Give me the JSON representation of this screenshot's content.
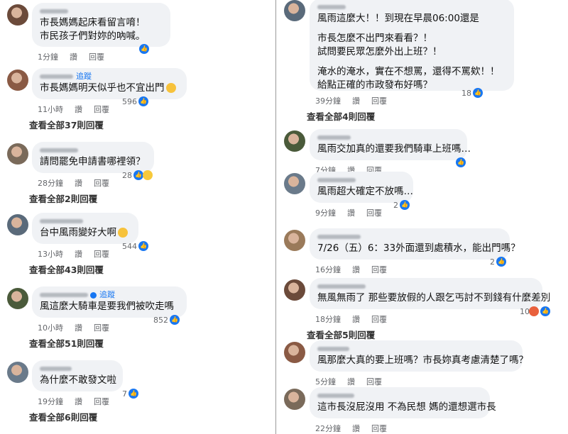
{
  "labels": {
    "like": "讚",
    "reply": "回覆",
    "follow": "追蹤"
  },
  "left": [
    {
      "lines": [
        "市長媽媽起床看留言唷！",
        "市民孩子們對妳的吶喊。"
      ],
      "time": "1分鐘",
      "count": "",
      "view_all": ""
    },
    {
      "lines": [
        "市長媽媽明天似乎也不宜出門"
      ],
      "time": "11小時",
      "count": "596",
      "view_all": "查看全部37則回覆"
    },
    {
      "lines": [
        "請問罷免申請書哪裡領？"
      ],
      "time": "28分鐘",
      "count": "28",
      "view_all": "查看全部2則回覆"
    },
    {
      "lines": [
        "台中風雨變好大啊"
      ],
      "time": "13小時",
      "count": "544",
      "view_all": "查看全部43則回覆"
    },
    {
      "lines": [
        "風這麼大騎車是要我們被吹走嗎"
      ],
      "time": "10小時",
      "count": "852",
      "view_all": "查看全部51則回覆"
    },
    {
      "lines": [
        "為什麼不敢發文啦"
      ],
      "time": "19分鐘",
      "count": "7",
      "view_all": "查看全部6則回覆"
    }
  ],
  "right": [
    {
      "lines": [
        "風雨這麼大！！到現在早晨06:00還是",
        "",
        "市長怎麼不出門來看看？！",
        "試問要民眾怎麼外出上班？！",
        "",
        "淹水的淹水，實在不想罵，還得不罵欸！！",
        "給點正確的市政發布好嗎？"
      ],
      "time": "39分鐘",
      "count": "18",
      "view_all": "查看全部4則回覆"
    },
    {
      "lines": [
        "風雨交加真的還要我們騎車上班嗎…"
      ],
      "time": "7分鐘",
      "count": "",
      "view_all": ""
    },
    {
      "lines": [
        "風雨超大確定不放嗎…"
      ],
      "time": "9分鐘",
      "count": "2",
      "view_all": ""
    },
    {
      "lines": [
        "7/26（五）6：33外面還到處積水，能出門嗎？"
      ],
      "time": "16分鐘",
      "count": "2",
      "view_all": ""
    },
    {
      "lines": [
        "無風無雨了 那些要放假的人跟乞丐討不到錢有什麼差別"
      ],
      "time": "18分鐘",
      "count": "10",
      "view_all": "查看全部5則回覆"
    },
    {
      "lines": [
        "風那麼大真的要上班嗎？市長妳真考慮清楚了嗎？"
      ],
      "time": "5分鐘",
      "count": "",
      "view_all": ""
    },
    {
      "lines": [
        "這市長沒屁沒用 不為民想 媽的還想選市長"
      ],
      "time": "22分鐘",
      "count": "",
      "view_all": ""
    }
  ]
}
